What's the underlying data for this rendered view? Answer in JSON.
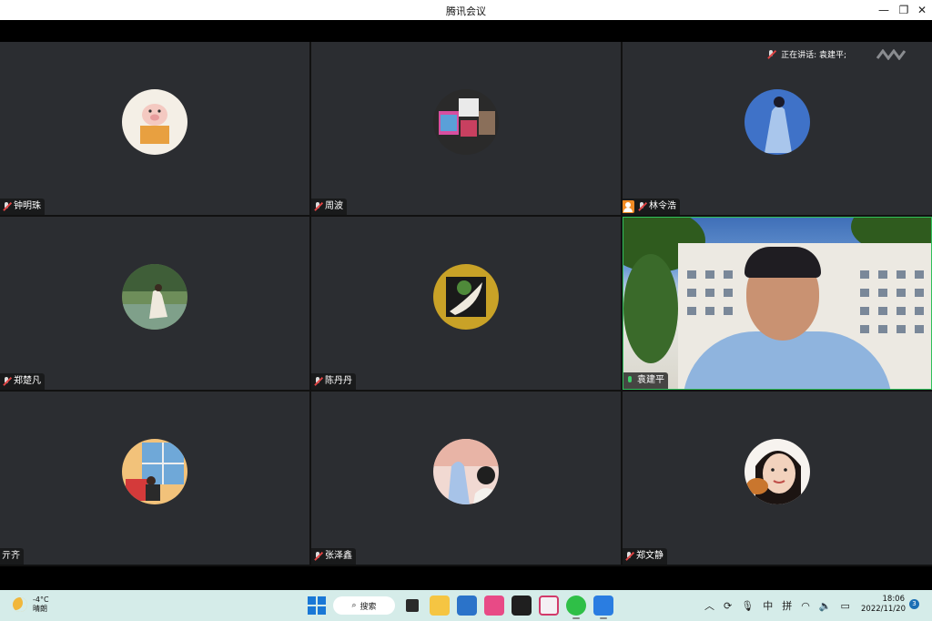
{
  "window": {
    "title": "腾讯会议",
    "minimize": "—",
    "restore": "❐",
    "close": "✕"
  },
  "meeting": {
    "speaking_label": "正在讲话: 袁建平;",
    "participants": [
      {
        "name": "钟明珠",
        "mic": "muted",
        "avatar": "cartoon-pig-avatar"
      },
      {
        "name": "周波",
        "mic": "muted",
        "avatar": "photo-collage-avatar"
      },
      {
        "name": "林令浩",
        "mic": "muted",
        "host": true,
        "avatar": "blue-illustration-avatar"
      },
      {
        "name": "郑楚凡",
        "mic": "muted",
        "avatar": "woman-by-lake-avatar"
      },
      {
        "name": "陈丹丹",
        "mic": "muted",
        "avatar": "gold-emblem-avatar"
      },
      {
        "name": "袁建平",
        "mic": "on",
        "video": true
      },
      {
        "name": "亓齐",
        "mic": "none",
        "avatar": "window-view-avatar"
      },
      {
        "name": "张泽鑫",
        "mic": "muted",
        "avatar": "sunset-hand-avatar"
      },
      {
        "name": "郑文静",
        "mic": "muted",
        "avatar": "girl-selfie-avatar"
      }
    ]
  },
  "taskbar": {
    "weather_temp": "-4°C",
    "weather_desc": "晴朗",
    "search_label": "搜索",
    "ime_lang": "中",
    "ime_mode": "拼",
    "time": "18:06",
    "date": "2022/11/20",
    "notification_count": "3"
  },
  "colors": {
    "tile_bg": "#2b2d31",
    "taskbar_bg": "#d5ece9",
    "host_badge": "#f08a24",
    "mic_on": "#3ccf6a",
    "mic_muted": "#e04444"
  }
}
